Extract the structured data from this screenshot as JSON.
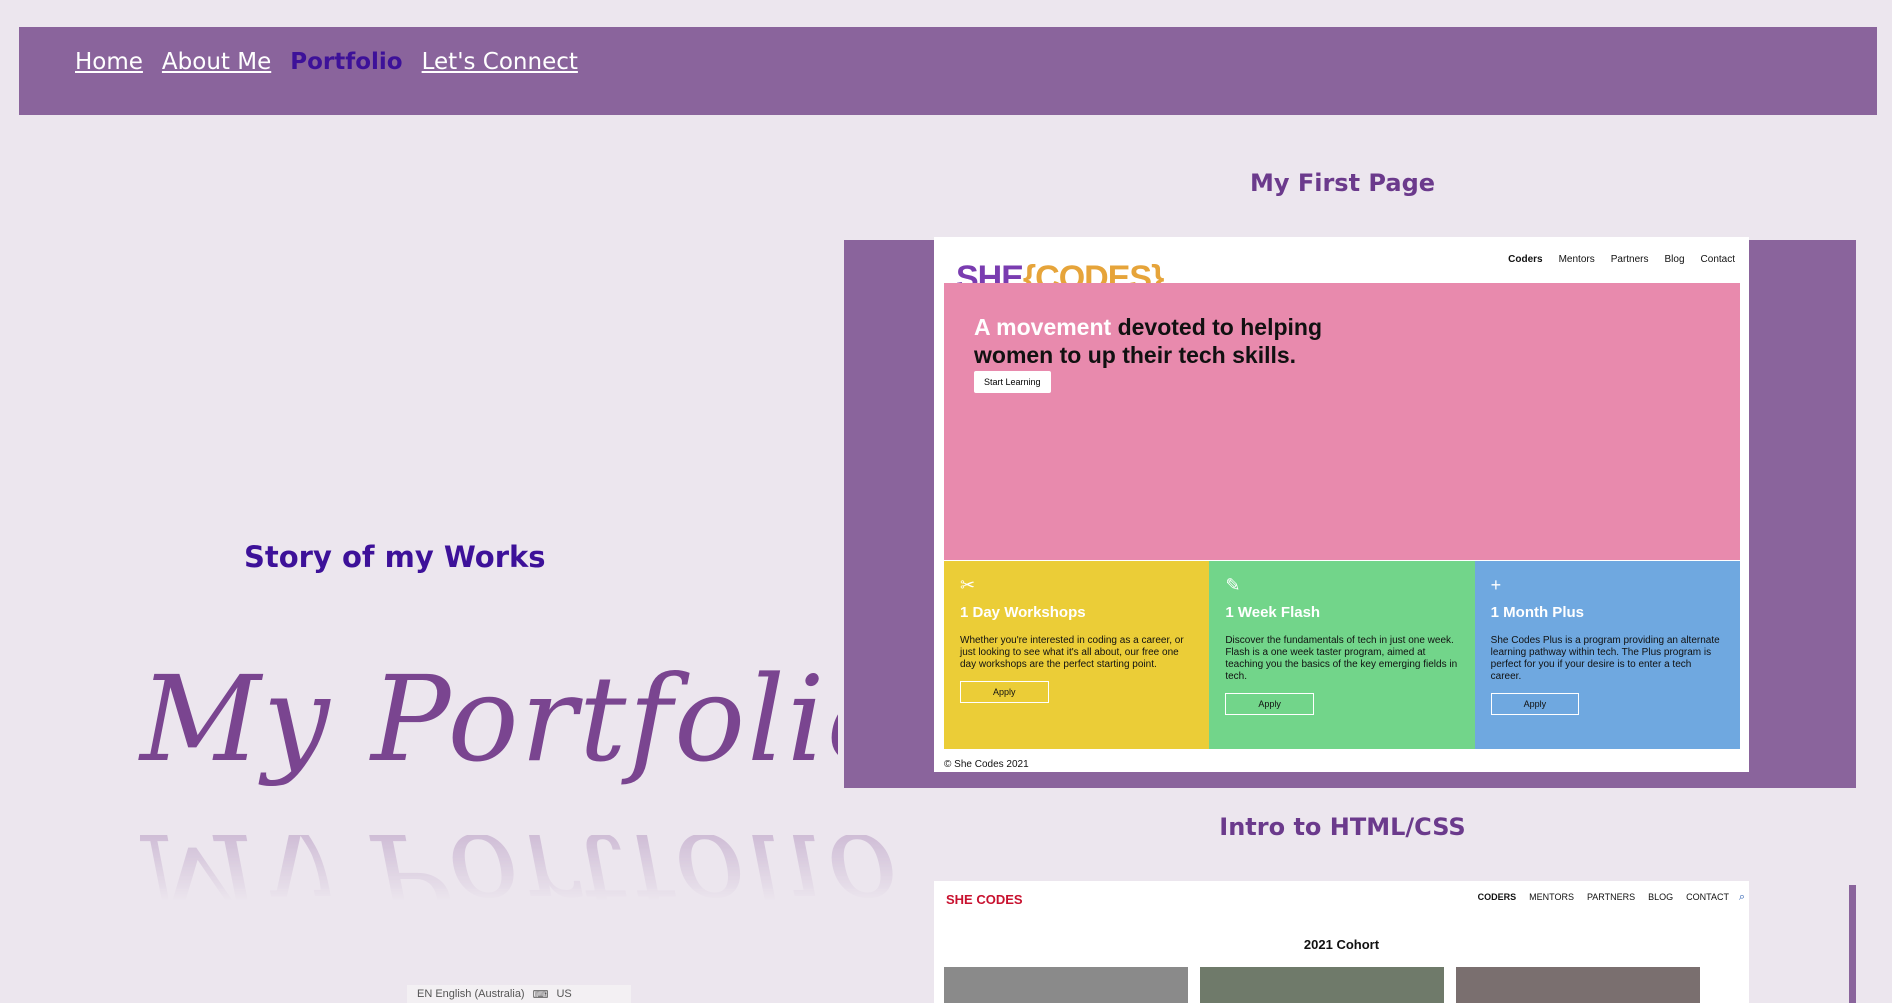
{
  "nav": {
    "items": [
      {
        "label": "Home",
        "active": false
      },
      {
        "label": "About Me",
        "active": false
      },
      {
        "label": "Portfolio",
        "active": true
      },
      {
        "label": "Let's Connect",
        "active": false
      }
    ]
  },
  "left": {
    "story_title": "Story of my Works",
    "script_title": "My Portfolio"
  },
  "projects": [
    {
      "title": "My First Page",
      "site": {
        "logo_she": "SHE",
        "logo_codes": "{CODES}",
        "nav": [
          "Coders",
          "Mentors",
          "Partners",
          "Blog",
          "Contact"
        ],
        "hero_highlight": "A movement",
        "hero_text": " devoted to helping women to up their tech skills.",
        "cta": "Start Learning",
        "cards": [
          {
            "icon": "scissors-icon",
            "glyph": "✂",
            "title": "1 Day Workshops",
            "desc": "Whether you're interested in coding as a career, or just looking to see what it's all about, our free one day workshops are the perfect starting point.",
            "button": "Apply",
            "color": "#ebcd37"
          },
          {
            "icon": "pencil-icon",
            "glyph": "✎",
            "title": "1 Week Flash",
            "desc": "Discover the fundamentals of tech in just one week. Flash is a one week taster program, aimed at teaching you the basics of the key emerging fields in tech.",
            "button": "Apply",
            "color": "#72d58a"
          },
          {
            "icon": "plus-icon",
            "glyph": "+",
            "title": "1 Month Plus",
            "desc": "She Codes Plus is a program providing an alternate learning pathway within tech. The Plus program is perfect for you if your desire is to enter a tech career.",
            "button": "Apply",
            "color": "#6fa8e0"
          }
        ],
        "footer": "© She Codes 2021"
      }
    },
    {
      "title": "Intro to HTML/CSS",
      "site": {
        "logo": "SHE CODES",
        "nav": [
          "CODERS",
          "MENTORS",
          "PARTNERS",
          "BLOG",
          "CONTACT"
        ],
        "heading": "2021 Cohort"
      }
    }
  ],
  "taskbar": {
    "language": "EN English (Australia)",
    "layout": "US"
  },
  "colors": {
    "background": "#ece6ee",
    "navbar": "#8a649c",
    "active_link": "#3d1199",
    "heading": "#6b3a8c"
  }
}
